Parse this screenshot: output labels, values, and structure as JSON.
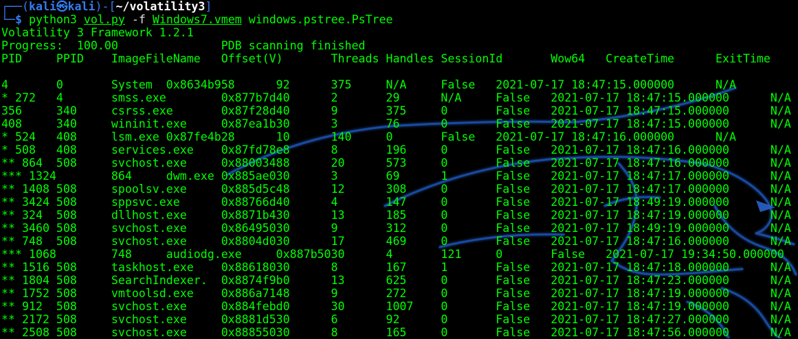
{
  "prompt": {
    "corner_top": "┌──(",
    "user": "kali",
    "at": "㉿",
    "host": "kali",
    "close_open": ")-[",
    "path": "~/volatility3",
    "close": "]",
    "corner_bottom": "└─",
    "dollar": "$"
  },
  "command": {
    "program": "python3",
    "script": "vol.py",
    "flag": "-f",
    "file": "Windows7.vmem",
    "plugin": "windows.pstree.PsTree"
  },
  "output": {
    "framework": "Volatility 3 Framework 1.2.1",
    "progress": "Progress:  100.00               PDB scanning finished",
    "header": "PID     PPID    ImageFileName   Offset(V)       Threads Handles SessionId       Wow64   CreateTime      ExitTime",
    "rows": [
      "4       0       System  0x8634b958      92      375     N/A     False   2021-07-17 18:47:15.000000      N/A",
      "* 272   4       smss.exe        0x877b7d40      2       29      N/A     False   2021-07-17 18:47:15.000000      N/A",
      "356     340     csrss.exe       0x87f28d40      9       375     0       False   2021-07-17 18:47:15.000000      N/A",
      "408     340     wininit.exe     0x87ea1b30      3       76      0       False   2021-07-17 18:47:15.000000      N/A",
      "* 524   408     lsm.exe 0x87fe4b28      10      140     0       False   2021-07-17 18:47:16.000000      N/A",
      "* 508   408     services.exe    0x87fd78e8      8       196     0       False   2021-07-17 18:47:16.000000      N/A",
      "** 864  508     svchost.exe     0x88003488      20      573     0       False   2021-07-17 18:47:16.000000      N/A",
      "*** 1324        864     dwm.exe 0x885ae030      3       69      1       False   2021-07-17 18:47:17.000000      N/A",
      "** 1408 508     spoolsv.exe     0x885d5c48      12      308     0       False   2021-07-17 18:47:17.000000      N/A",
      "** 3424 508     sppsvc.exe      0x88766d40      4       147     0       False   2021-07-17 18:49:19.000000      N/A",
      "** 324  508     dllhost.exe     0x8871b430      13      185     0       False   2021-07-17 18:47:19.000000      N/A",
      "** 3460 508     svchost.exe     0x86495030      9       312     0       False   2021-07-17 18:49:19.000000      N/A",
      "** 748  508     svchost.exe     0x8804d030      17      469     0       False   2021-07-17 18:47:16.000000      N/A",
      "*** 1068        748     audiodg.exe     0x887b5030      4       121     0       False   2021-07-17 19:34:50.000000",
      "** 1516 508     taskhost.exe    0x88618030      8       167     1       False   2021-07-17 18:47:18.000000      N/A",
      "** 1804 508     SearchIndexer.  0x8874f9b0      13      625     0       False   2021-07-17 18:47:23.000000      N/A",
      "** 1752 508     vmtoolsd.exe    0x886a7148      9       272     0       False   2021-07-17 18:47:19.000000      N/A",
      "** 912  508     svchost.exe     0x884febd0      30      1007    0       False   2021-07-17 18:47:19.000000      N/A",
      "** 2172 508     svchost.exe     0x8881d530      6       92      0       False   2021-07-17 18:47:27.000000      N/A",
      "** 2508 508     svchost.exe     0x88855030      8       165     0       False   2021-07-17 18:47:56.000000      N/A"
    ]
  },
  "colors": {
    "background": "#000000",
    "text_green": "#00ff00",
    "prompt_blue": "#367bf0",
    "dragon_blue": "#1f4fa8"
  },
  "icons": {
    "wallpaper": "kali-dragon-logo"
  }
}
